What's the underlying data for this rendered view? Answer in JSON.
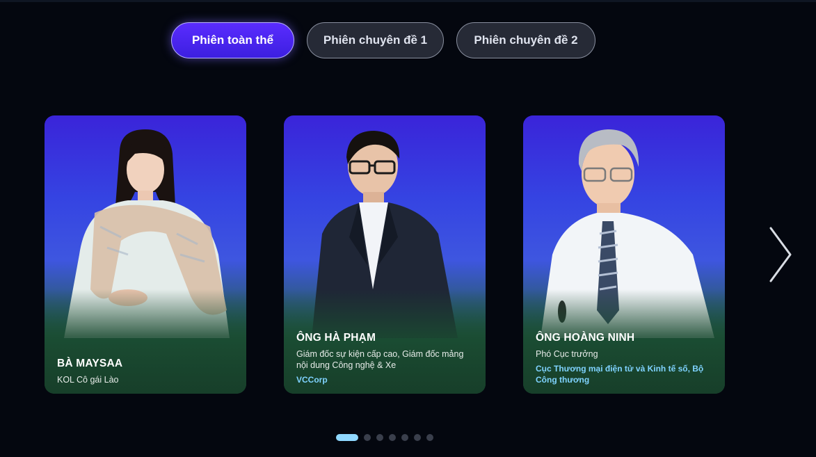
{
  "tabs": [
    {
      "label": "Phiên toàn thể",
      "active": true
    },
    {
      "label": "Phiên chuyên đề 1",
      "active": false
    },
    {
      "label": "Phiên chuyên đề 2",
      "active": false
    }
  ],
  "speakers": [
    {
      "name": "BÀ MAYSAA",
      "role": "KOL Cô gái Lào",
      "org": ""
    },
    {
      "name": "ÔNG HÀ PHẠM",
      "role": "Giám đốc sự kiện cấp cao, Giám đốc mảng nội dung Công nghệ & Xe",
      "org": "VCCorp"
    },
    {
      "name": "ÔNG HOÀNG NINH",
      "role": "Phó Cục trưởng",
      "org": "Cục Thương mại điện tử và Kinh tế số, Bộ Công thương"
    }
  ],
  "pagination": {
    "total": 7,
    "current": 1
  },
  "next_icon": "chevron-right-icon",
  "colors": {
    "accent": "#5a2cff",
    "dot_active": "#8fd8ff",
    "org_text": "#7fd3ff",
    "background": "#04070f"
  }
}
